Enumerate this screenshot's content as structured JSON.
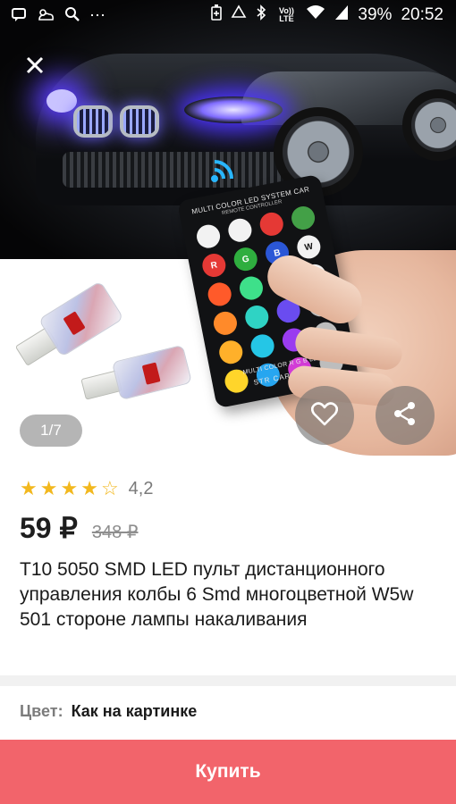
{
  "status_bar": {
    "battery_percent": "39%",
    "time": "20:52",
    "lte_label": "Vo)) LTE",
    "icons_left": [
      "notification-icon",
      "weather-icon",
      "search-icon",
      "more-icon"
    ],
    "icons_right": [
      "battery-saver-icon",
      "recycle-icon",
      "bluetooth-icon",
      "lte-icon",
      "wifi-icon",
      "signal-icon"
    ]
  },
  "gallery": {
    "counter": "1/7",
    "remote": {
      "title": "MULTI COLOR LED SYSTEM CAR",
      "subtitle": "REMOTE CONTROLLER",
      "footer1": "MULTI COLOR R G B LED",
      "footer2": "STR CAR MATE",
      "buttons": [
        {
          "label": "",
          "color": "#f2f2f2"
        },
        {
          "label": "",
          "color": "#f2f2f2"
        },
        {
          "label": "",
          "color": "#e53935"
        },
        {
          "label": "",
          "color": "#43a047"
        },
        {
          "label": "R",
          "color": "#e53935"
        },
        {
          "label": "G",
          "color": "#2fae3f"
        },
        {
          "label": "B",
          "color": "#2b57d6"
        },
        {
          "label": "W",
          "color": "#f2f2f2"
        },
        {
          "label": "",
          "color": "#ff5a2a"
        },
        {
          "label": "",
          "color": "#3ee08a"
        },
        {
          "label": "",
          "color": "#2f7df0"
        },
        {
          "label": "FLASH",
          "color": "#f2f2f2"
        },
        {
          "label": "",
          "color": "#ff8a2a"
        },
        {
          "label": "",
          "color": "#2fd3c4"
        },
        {
          "label": "",
          "color": "#6a4cf0"
        },
        {
          "label": "",
          "color": "#bdbdbd"
        },
        {
          "label": "",
          "color": "#ffb02a"
        },
        {
          "label": "",
          "color": "#25c6e6"
        },
        {
          "label": "",
          "color": "#9a3cf0"
        },
        {
          "label": "",
          "color": "#bdbdbd"
        },
        {
          "label": "",
          "color": "#ffd52a"
        },
        {
          "label": "",
          "color": "#27a6f0"
        },
        {
          "label": "",
          "color": "#d23cd6"
        },
        {
          "label": "",
          "color": "#bdbdbd"
        }
      ]
    }
  },
  "product": {
    "rating_value": "4,2",
    "stars_full": 4,
    "stars_total": 5,
    "price": "59 ₽",
    "old_price": "348 ₽",
    "title": "T10 5050 SMD LED пульт дистанционного управления колбы 6 Smd многоцветной W5w 501 стороне лампы накаливания"
  },
  "options": {
    "label": "Цвет:",
    "value": "Как на картинке"
  },
  "actions": {
    "buy_label": "Купить"
  },
  "colors": {
    "buy_button": "#f2646b",
    "star": "#f2b81e"
  }
}
